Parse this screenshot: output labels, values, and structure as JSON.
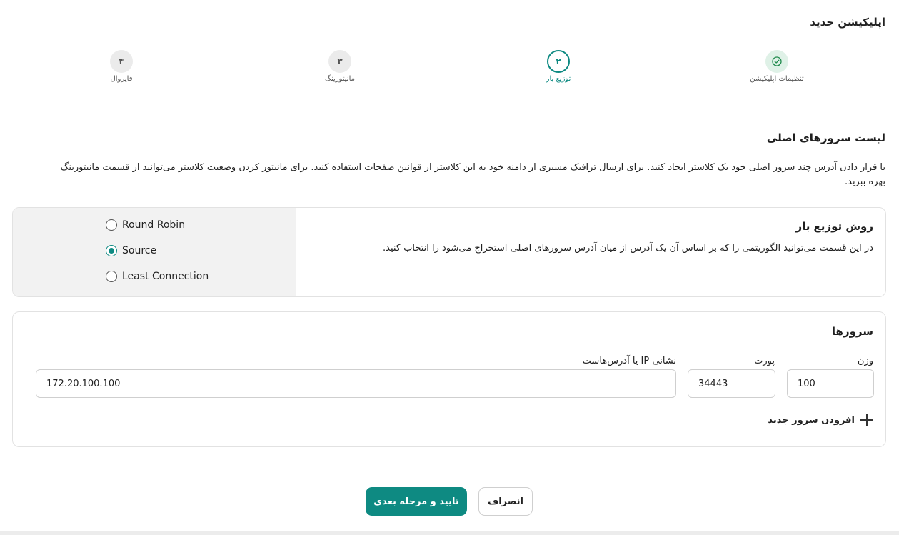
{
  "page": {
    "title": "اپلیکیشن جدید"
  },
  "stepper": {
    "steps": [
      {
        "label": "تنظیمات اپلیکیشن",
        "number": "",
        "state": "done"
      },
      {
        "label": "توزیع بار",
        "number": "۲",
        "state": "active"
      },
      {
        "label": "مانیتورینگ",
        "number": "۳",
        "state": "pending"
      },
      {
        "label": "فایروال",
        "number": "۴",
        "state": "pending"
      }
    ]
  },
  "section": {
    "title": "لیست سرورهای اصلی",
    "description": "با قرار دادن آدرس چند سرور اصلی خود یک کلاستر ایجاد کنید. برای ارسال ترافیک مسیری از دامنه خود به این کلاستر از قوانین صفحات استفاده کنید. برای مانیتور کردن وضعیت کلاستر می‌توانید از قسمت مانیتورینگ بهره ببرید."
  },
  "load_balancing": {
    "title": "روش توزیع بار",
    "description": "در این قسمت می‌توانید الگوریتمی را که بر اساس آن یک آدرس از میان آدرس سرورهای اصلی استخراج می‌شود را انتخاب کنید.",
    "options": [
      {
        "label": "Round Robin",
        "checked": false
      },
      {
        "label": "Source",
        "checked": true
      },
      {
        "label": "Least Connection",
        "checked": false
      }
    ]
  },
  "servers": {
    "title": "سرورها",
    "weight_label": "وزن",
    "port_label": "پورت",
    "host_label": "نشانی IP یا آدرس‌هاست",
    "weight_value": "100",
    "port_value": "34443",
    "host_value": "172.20.100.100",
    "add_label": "افزودن سرور جدید"
  },
  "footer": {
    "confirm_label": "تایید و مرحله بعدی",
    "cancel_label": "انصراف"
  },
  "colors": {
    "accent": "#0e8a82",
    "done_bg": "#dff1e7",
    "done_check": "#1f8a4c"
  }
}
